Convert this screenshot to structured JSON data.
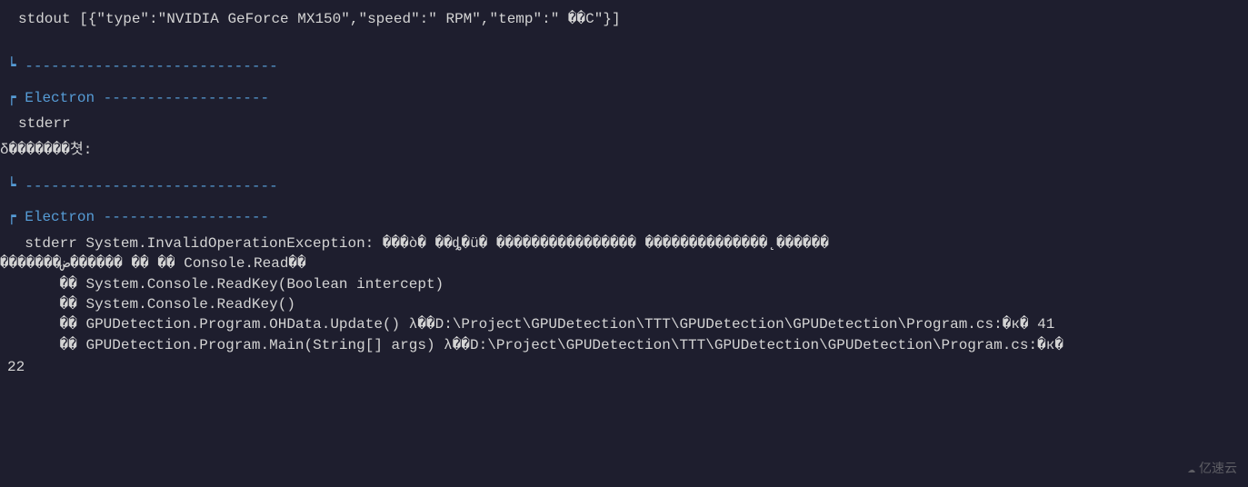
{
  "console": {
    "stdout_line": "stdout [{\"type\":\"NVIDIA GeForce MX150\",\"speed\":\" RPM\",\"temp\":\" ��C\"}]",
    "divider_top_1": "┕ -----------------------------",
    "electron_header_1": "┍ Electron -------------------",
    "stderr_block_1_line1": "stderr",
    "stderr_block_1_line2": "δ�������쳣:",
    "divider_bottom_1": "┕ -----------------------------",
    "electron_header_2": "┍ Electron -------------------",
    "stderr_exception_line1": "  stderr System.InvalidOperationException: ���ò� ��ȡ�ü� ���������������� ������򲻴��������̨������",
    "stderr_exception_line2": "�������ض��򡣳���� �� �� Console.Read��",
    "stack_line1": "      �� System.Console.ReadKey(Boolean intercept)",
    "stack_line2": "      �� System.Console.ReadKey()",
    "stack_line3": "      �� GPUDetection.Program.OHData.Update() λ��D:\\Project\\GPUDetection\\TTT\\GPUDetection\\GPUDetection\\Program.cs:�к� 41",
    "stack_line4": "      �� GPUDetection.Program.Main(String[] args) λ��D:\\Project\\GPUDetection\\TTT\\GPUDetection\\GPUDetection\\Program.cs:�к�",
    "line_number": "22"
  },
  "watermark": {
    "text": "亿速云",
    "icon": "☁"
  }
}
